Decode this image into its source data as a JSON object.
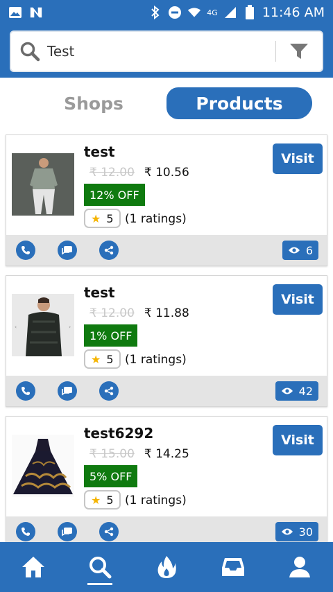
{
  "status_bar": {
    "time": "11:46 AM",
    "network": "4G",
    "left_icons": [
      "image-icon",
      "n-notification-icon"
    ],
    "right_icons": [
      "bluetooth-icon",
      "do-not-disturb-icon",
      "wifi-icon",
      "signal-icon",
      "battery-icon"
    ]
  },
  "search": {
    "query": "Test",
    "icon": "search-icon",
    "filter_icon": "filter-icon"
  },
  "tabs": [
    {
      "label": "Shops",
      "active": false
    },
    {
      "label": "Products",
      "active": true
    }
  ],
  "products": [
    {
      "name": "test",
      "old_price": "₹ 12.00",
      "price": "₹ 10.56",
      "discount": "12% OFF",
      "rating": "5",
      "ratings_count": "(1 ratings)",
      "visit_label": "Visit",
      "views": "6",
      "image": "gray-shirt-model"
    },
    {
      "name": "test",
      "old_price": "₹ 12.00",
      "price": "₹ 11.88",
      "discount": "1% OFF",
      "rating": "5",
      "ratings_count": "(1 ratings)",
      "visit_label": "Visit",
      "views": "42",
      "image": "black-shirt-model"
    },
    {
      "name": "test6292",
      "old_price": "₹ 15.00",
      "price": "₹ 14.25",
      "discount": "5% OFF",
      "rating": "5",
      "ratings_count": "(1 ratings)",
      "visit_label": "Visit",
      "views": "30",
      "image": "embroidered-lehenga"
    }
  ],
  "bottom_nav": [
    {
      "icon": "home-icon",
      "active": false
    },
    {
      "icon": "search-icon",
      "active": true
    },
    {
      "icon": "fire-icon",
      "active": false
    },
    {
      "icon": "inbox-icon",
      "active": false
    },
    {
      "icon": "profile-icon",
      "active": false
    }
  ],
  "colors": {
    "primary": "#2a6fba",
    "discount": "#0f7a0f",
    "star": "#f5b400"
  }
}
